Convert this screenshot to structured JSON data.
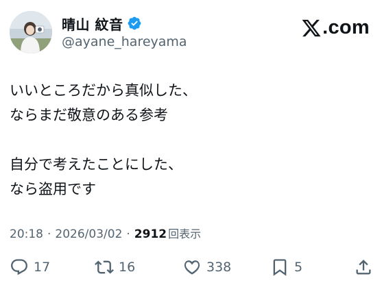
{
  "author": {
    "display_name": "晴山 紋音",
    "handle": "@ayane_hareyama",
    "verified": true
  },
  "brand": {
    "logo_text": ".com",
    "logo_icon": "x-logo-icon"
  },
  "tweet": {
    "lines": [
      "いいところだから真似した、",
      "ならまだ敬意のある参考",
      "",
      "自分で考えたことにした、",
      "なら盗用です"
    ]
  },
  "meta": {
    "time": "20:18",
    "separator": "·",
    "date": "2026/03/02",
    "views_count": "2912",
    "views_label": "回表示"
  },
  "actions": {
    "replies": "17",
    "reposts": "16",
    "likes": "338",
    "bookmarks": "5",
    "icons": [
      "reply-icon",
      "repost-icon",
      "like-icon",
      "bookmark-icon",
      "share-icon"
    ]
  },
  "colors": {
    "text": "#0f1419",
    "secondary": "#536471",
    "verified": "#1d9bf0",
    "background": "#ffffff"
  }
}
